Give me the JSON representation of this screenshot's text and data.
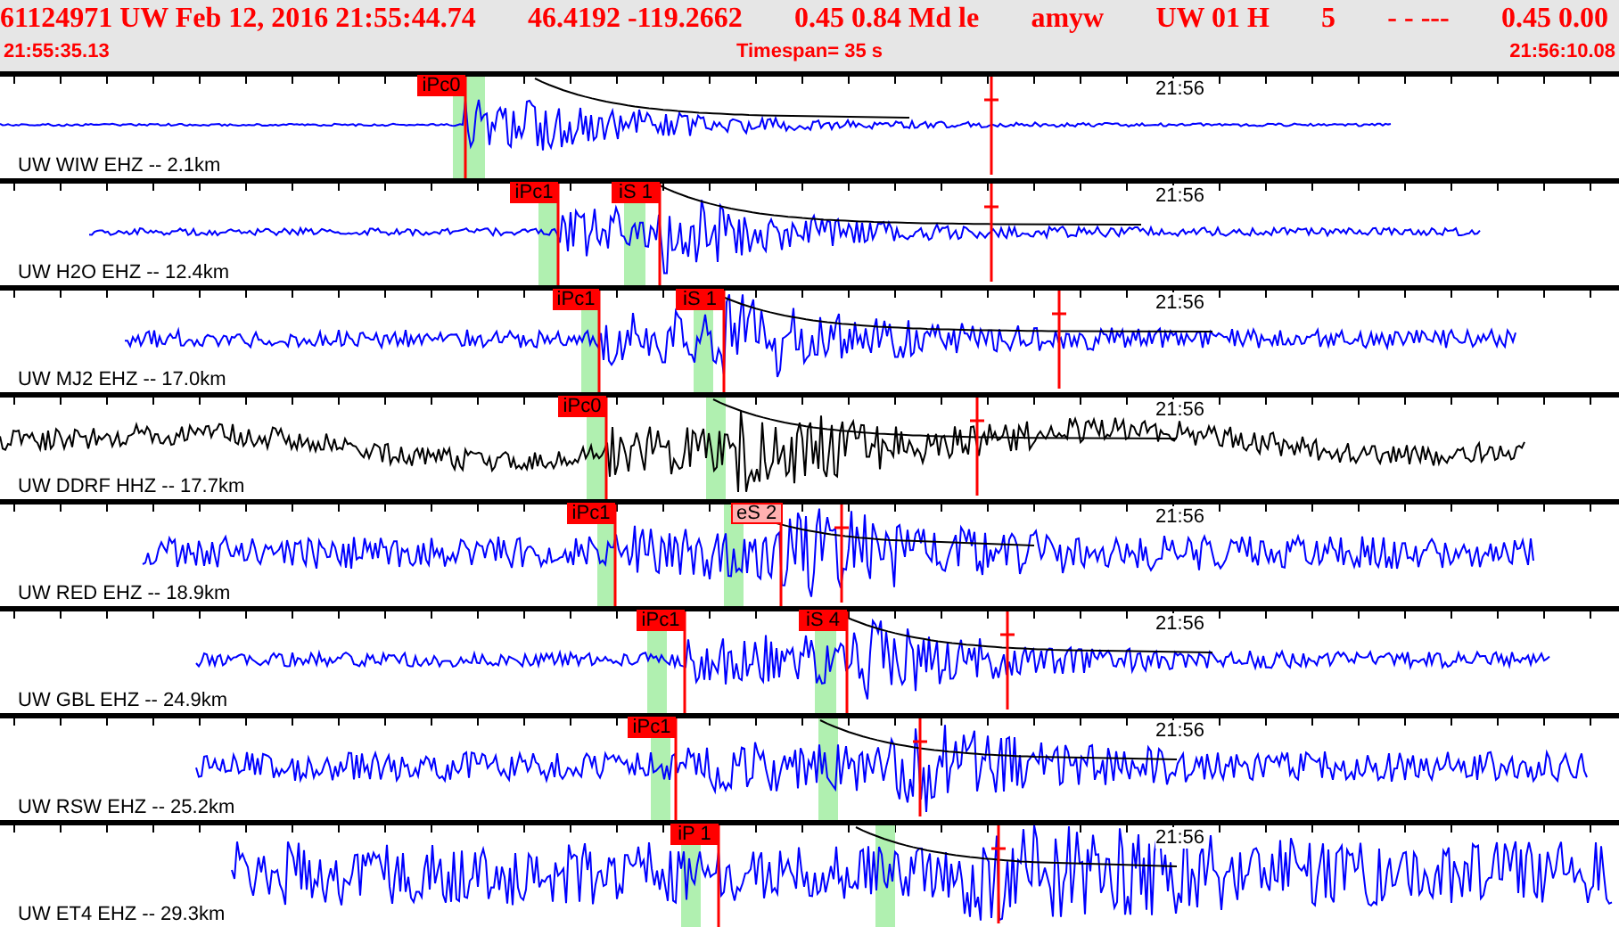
{
  "header": {
    "event": [
      "61124971 UW Feb 12, 2016 21:55:44.74",
      "46.4192 -119.2662",
      "0.45 0.84 Md le",
      "amyw",
      "UW 01 H",
      "5",
      "- - ---",
      "0.45 0.00"
    ],
    "start_time": "21:55:35.13",
    "timespan": "Timespan=  35 s",
    "end_time": "21:56:10.08"
  },
  "traces": [
    {
      "label": "UW WIW EHZ -- 2.1km",
      "time_mark": "21:56",
      "color": "#0000ff",
      "picks": [
        {
          "label": "iPc0",
          "kind": "impulsive"
        }
      ]
    },
    {
      "label": "UW H2O EHZ -- 12.4km",
      "time_mark": "21:56",
      "color": "#0000ff",
      "picks": [
        {
          "label": "iPc1",
          "kind": "impulsive"
        },
        {
          "label": "iS 1",
          "kind": "impulsive"
        }
      ]
    },
    {
      "label": "UW MJ2 EHZ -- 17.0km",
      "time_mark": "21:56",
      "color": "#0000ff",
      "picks": [
        {
          "label": "iPc1",
          "kind": "impulsive"
        },
        {
          "label": "iS 1",
          "kind": "impulsive"
        }
      ]
    },
    {
      "label": "UW DDRF HHZ -- 17.7km",
      "time_mark": "21:56",
      "color": "#000000",
      "picks": [
        {
          "label": "iPc0",
          "kind": "impulsive"
        }
      ]
    },
    {
      "label": "UW RED EHZ -- 18.9km",
      "time_mark": "21:56",
      "color": "#0000ff",
      "picks": [
        {
          "label": "iPc1",
          "kind": "impulsive"
        },
        {
          "label": "eS 2",
          "kind": "emergent"
        }
      ]
    },
    {
      "label": "UW GBL EHZ -- 24.9km",
      "time_mark": "21:56",
      "color": "#0000ff",
      "picks": [
        {
          "label": "iPc1",
          "kind": "impulsive"
        },
        {
          "label": "iS 4",
          "kind": "impulsive"
        }
      ]
    },
    {
      "label": "UW RSW EHZ -- 25.2km",
      "time_mark": "21:56",
      "color": "#0000ff",
      "picks": [
        {
          "label": "iPc1",
          "kind": "impulsive"
        }
      ]
    },
    {
      "label": "UW ET4 EHZ -- 29.3km",
      "time_mark": "21:56",
      "color": "#0000ff",
      "picks": [
        {
          "label": "iP 1",
          "kind": "impulsive"
        }
      ]
    }
  ]
}
